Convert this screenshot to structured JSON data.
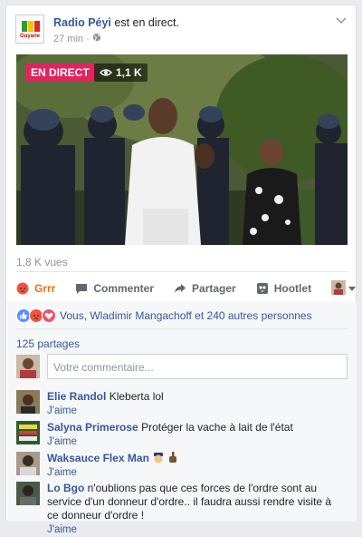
{
  "post": {
    "author": "Radio Péyi",
    "status": " est en direct.",
    "time": "27 min",
    "logo_text": "Guyane"
  },
  "video": {
    "live_label": "EN DIRECT",
    "viewers": "1,1 K"
  },
  "stats": {
    "views": "1,8 K vues"
  },
  "actions": {
    "grrr": "Grrr",
    "comment": "Commenter",
    "share": "Partager",
    "hootlet": "Hootlet"
  },
  "reactions": {
    "text": "Vous, Wladimir Mangachoff et 240 autres personnes",
    "colors": {
      "like": "#5890ff",
      "angry": "#f5533d",
      "love": "#f25268"
    }
  },
  "shares": "125 partages",
  "compose": {
    "placeholder": "Votre commentaire..."
  },
  "comments": [
    {
      "name": "Elie Randol",
      "text": "Kleberta lol",
      "like": "J'aime"
    },
    {
      "name": "Salyna Primerose",
      "text": "Protéger la vache à lait de l'état",
      "like": "J'aime"
    },
    {
      "name": "Waksauce Flex Man",
      "text": "",
      "like": "J'aime"
    },
    {
      "name": "Lo Bgo",
      "text": "n'oublions pas que ces forces de l'ordre sont au service d'un donneur d'ordre.. il faudra aussi rendre visite à ce donneur d'ordre !",
      "like": "J'aime"
    }
  ]
}
